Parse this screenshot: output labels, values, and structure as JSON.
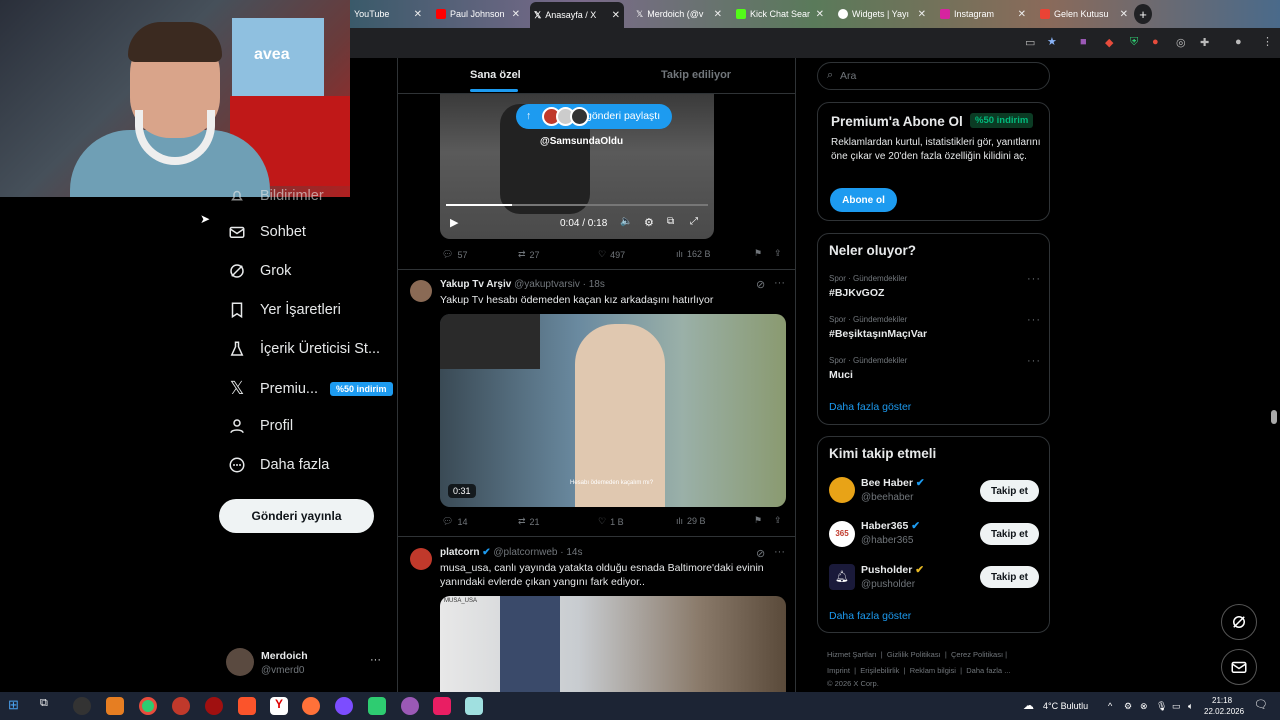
{
  "browser": {
    "tabs": [
      {
        "label": "YouTube"
      },
      {
        "label": "Paul Johnson"
      },
      {
        "label": "Anasayfa / X"
      },
      {
        "label": "Merdoich (@v"
      },
      {
        "label": "Kick Chat Sear"
      },
      {
        "label": "Widgets | Yayı"
      },
      {
        "label": "Instagram"
      },
      {
        "label": "Gelen Kutusu"
      }
    ]
  },
  "cam": {
    "jersey": "avea"
  },
  "nav": {
    "items": [
      {
        "label": "Bildirimler"
      },
      {
        "label": "Sohbet"
      },
      {
        "label": "Grok"
      },
      {
        "label": "Yer İşaretleri"
      },
      {
        "label": "İçerik Üreticisi St..."
      },
      {
        "label": "Premiu..."
      },
      {
        "label": "Profil"
      },
      {
        "label": "Daha fazla"
      }
    ],
    "premium_badge": "%50 indirim",
    "post_button": "Gönderi yayınla",
    "account": {
      "name": "Merdoich",
      "handle": "@vmerd0"
    }
  },
  "feed": {
    "tabs": [
      "Sana özel",
      "Takip ediliyor"
    ],
    "share_pill": "gönderi paylaştı",
    "video1": {
      "overlay": "@SamsundaOldu",
      "time": "0:04 / 0:18"
    },
    "tweet1_actions": [
      "57",
      "27",
      "497",
      "162 B"
    ],
    "tweet2": {
      "name": "Yakup Tv Arşiv",
      "handle": "@yakuptvarsiv · 18s",
      "text": "Yakup Tv hesabı ödemeden kaçan kız arkadaşını hatırlıyor",
      "duration": "0:31",
      "caption": "Hesabı ödemeden kaçalım mı?",
      "actions": [
        "14",
        "21",
        "1 B",
        "29 B"
      ]
    },
    "tweet3": {
      "name": "platcorn",
      "handle": "@platcornweb · 14s",
      "text": "musa_usa, canlı yayında yatakta olduğu esnada Baltimore'daki evinin yanındaki evlerde çıkan yangını fark ediyor..",
      "media_tag": "MUSA_USA"
    }
  },
  "search": {
    "placeholder": "Ara"
  },
  "premium": {
    "title": "Premium'a Abone Ol",
    "badge": "%50 indirim",
    "text": "Reklamlardan kurtul, istatistikleri gör, yanıtlarını öne çıkar ve 20'den fazla özelliğin kilidini aç.",
    "button": "Abone ol"
  },
  "trends": {
    "title": "Neler oluyor?",
    "items": [
      {
        "meta": "Spor · Gündemdekiler",
        "tag": "#BJKvGOZ"
      },
      {
        "meta": "Spor · Gündemdekiler",
        "tag": "#BeşiktaşınMaçıVar"
      },
      {
        "meta": "Spor · Gündemdekiler",
        "tag": "Muci"
      }
    ],
    "more": "Daha fazla göster"
  },
  "who": {
    "title": "Kimi takip etmeli",
    "items": [
      {
        "name": "Bee Haber",
        "handle": "@beehaber",
        "button": "Takip et",
        "color": "#e8a317"
      },
      {
        "name": "Haber365",
        "handle": "@haber365",
        "button": "Takip et",
        "color": "#ffffff"
      },
      {
        "name": "Pusholder",
        "handle": "@pusholder",
        "button": "Takip et",
        "color": "#1a1a3a"
      }
    ],
    "more": "Daha fazla göster"
  },
  "footer": {
    "row1": [
      "Hizmet Şartları",
      "Gizlilik Politikası",
      "Çerez Politikası"
    ],
    "row2": [
      "Imprint",
      "Erişilebilirlik",
      "Reklam bilgisi",
      "Daha fazla ..."
    ],
    "copy": "© 2026 X Corp."
  },
  "taskbar": {
    "weather": "4°C  Bulutlu",
    "time": "21:18",
    "date": "22.02.2026"
  }
}
